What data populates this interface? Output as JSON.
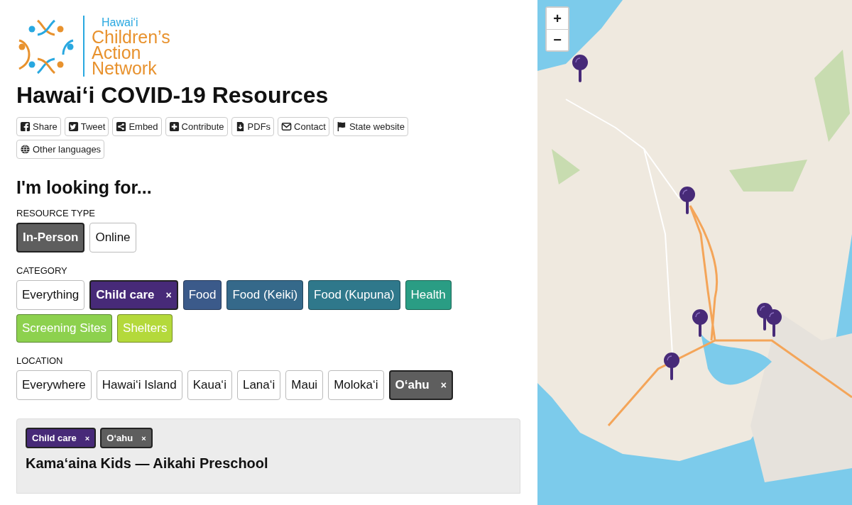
{
  "logo": {
    "tagline": "Hawai‘i",
    "name_lines": [
      "Children’s",
      "Action",
      "Network"
    ]
  },
  "title": "Hawai‘i COVID-19 Resources",
  "actions": [
    {
      "kind": "facebook",
      "label": "Share"
    },
    {
      "kind": "twitter",
      "label": "Tweet"
    },
    {
      "kind": "share",
      "label": "Embed"
    },
    {
      "kind": "plus",
      "label": "Contribute"
    },
    {
      "kind": "download",
      "label": "PDFs"
    },
    {
      "kind": "envelope",
      "label": "Contact"
    },
    {
      "kind": "flag",
      "label": "State website"
    },
    {
      "kind": "globe",
      "label": "Other languages"
    }
  ],
  "heading": "I'm looking for...",
  "filters": [
    {
      "label": "RESOURCE TYPE",
      "kind": "single",
      "options": [
        {
          "label": "In-Person",
          "selected": true
        },
        {
          "label": "Online",
          "selected": false
        }
      ]
    },
    {
      "label": "CATEGORY",
      "kind": "multi",
      "options": [
        {
          "label": "Everything",
          "selected": false
        },
        {
          "label": "Child care",
          "selected": true,
          "color": "#472a78"
        },
        {
          "label": "Food",
          "selected": false,
          "color": "#3b5a8a"
        },
        {
          "label": "Food (Keiki)",
          "selected": false,
          "color": "#35698a"
        },
        {
          "label": "Food (Kupuna)",
          "selected": false,
          "color": "#2f788b"
        },
        {
          "label": "Health",
          "selected": false,
          "color": "#2a9d84"
        },
        {
          "label": "Screening Sites",
          "selected": false,
          "color": "#8dd14e"
        },
        {
          "label": "Shelters",
          "selected": false,
          "color": "#b4d93b"
        }
      ]
    },
    {
      "label": "LOCATION",
      "kind": "multi",
      "options": [
        {
          "label": "Everywhere",
          "selected": false
        },
        {
          "label": "Hawai‘i Island",
          "selected": false
        },
        {
          "label": "Kaua‘i",
          "selected": false
        },
        {
          "label": "Lana‘i",
          "selected": false
        },
        {
          "label": "Maui",
          "selected": false
        },
        {
          "label": "Moloka‘i",
          "selected": false
        },
        {
          "label": "O‘ahu",
          "selected": true
        }
      ]
    }
  ],
  "results": [
    {
      "tags": [
        {
          "label": "Child care",
          "color": "#472a78",
          "remove": "×"
        },
        {
          "label": "O‘ahu",
          "color": "#5e5e5e",
          "remove": "×"
        }
      ],
      "title": "Kama‘aina Kids — Aikahi Preschool"
    }
  ],
  "map": {
    "zoom_in": "+",
    "zoom_out": "−"
  },
  "remove_mark": "×"
}
